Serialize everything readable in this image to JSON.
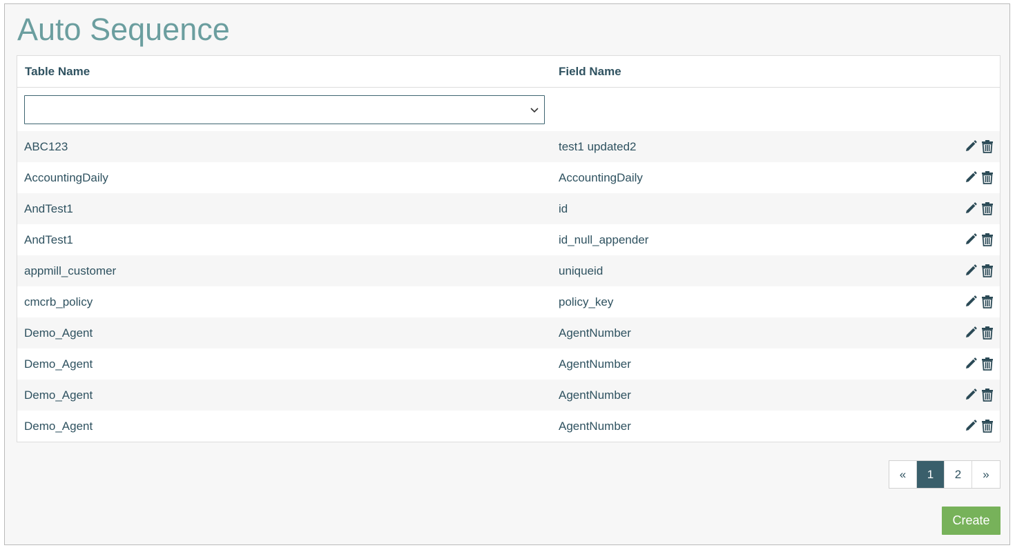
{
  "page": {
    "title": "Auto Sequence"
  },
  "table": {
    "columns": [
      "Table Name",
      "Field Name"
    ],
    "filter": {
      "table_name_value": ""
    },
    "rows": [
      {
        "table_name": "ABC123",
        "field_name": "test1 updated2"
      },
      {
        "table_name": "AccountingDaily",
        "field_name": "AccountingDaily"
      },
      {
        "table_name": "AndTest1",
        "field_name": "id"
      },
      {
        "table_name": "AndTest1",
        "field_name": "id_null_appender"
      },
      {
        "table_name": "appmill_customer",
        "field_name": "uniqueid"
      },
      {
        "table_name": "cmcrb_policy",
        "field_name": "policy_key"
      },
      {
        "table_name": "Demo_Agent",
        "field_name": "AgentNumber"
      },
      {
        "table_name": "Demo_Agent",
        "field_name": "AgentNumber"
      },
      {
        "table_name": "Demo_Agent",
        "field_name": "AgentNumber"
      },
      {
        "table_name": "Demo_Agent",
        "field_name": "AgentNumber"
      }
    ],
    "row_actions": {
      "edit_icon": "pencil-icon",
      "delete_icon": "trash-icon"
    }
  },
  "pagination": {
    "prev_label": "«",
    "pages": [
      "1",
      "2"
    ],
    "current_page": "1",
    "next_label": "»"
  },
  "actions": {
    "create_label": "Create"
  },
  "colors": {
    "title": "#6b9e9f",
    "text": "#2f5260",
    "active_page": "#3a5f6b",
    "create_button": "#77b25a"
  }
}
